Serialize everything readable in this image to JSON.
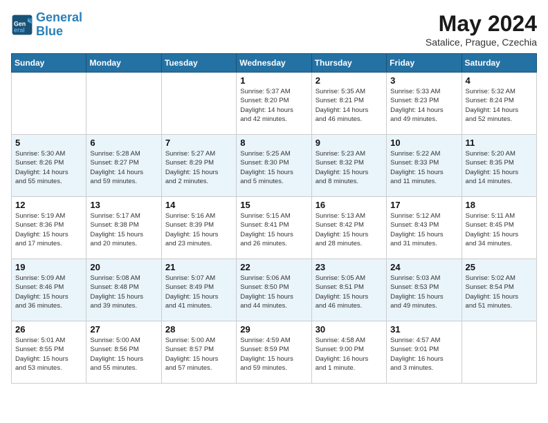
{
  "header": {
    "logo_line1": "General",
    "logo_line2": "Blue",
    "title": "May 2024",
    "location": "Satalice, Prague, Czechia"
  },
  "weekdays": [
    "Sunday",
    "Monday",
    "Tuesday",
    "Wednesday",
    "Thursday",
    "Friday",
    "Saturday"
  ],
  "weeks": [
    [
      {
        "day": "",
        "detail": ""
      },
      {
        "day": "",
        "detail": ""
      },
      {
        "day": "",
        "detail": ""
      },
      {
        "day": "1",
        "detail": "Sunrise: 5:37 AM\nSunset: 8:20 PM\nDaylight: 14 hours\nand 42 minutes."
      },
      {
        "day": "2",
        "detail": "Sunrise: 5:35 AM\nSunset: 8:21 PM\nDaylight: 14 hours\nand 46 minutes."
      },
      {
        "day": "3",
        "detail": "Sunrise: 5:33 AM\nSunset: 8:23 PM\nDaylight: 14 hours\nand 49 minutes."
      },
      {
        "day": "4",
        "detail": "Sunrise: 5:32 AM\nSunset: 8:24 PM\nDaylight: 14 hours\nand 52 minutes."
      }
    ],
    [
      {
        "day": "5",
        "detail": "Sunrise: 5:30 AM\nSunset: 8:26 PM\nDaylight: 14 hours\nand 55 minutes."
      },
      {
        "day": "6",
        "detail": "Sunrise: 5:28 AM\nSunset: 8:27 PM\nDaylight: 14 hours\nand 59 minutes."
      },
      {
        "day": "7",
        "detail": "Sunrise: 5:27 AM\nSunset: 8:29 PM\nDaylight: 15 hours\nand 2 minutes."
      },
      {
        "day": "8",
        "detail": "Sunrise: 5:25 AM\nSunset: 8:30 PM\nDaylight: 15 hours\nand 5 minutes."
      },
      {
        "day": "9",
        "detail": "Sunrise: 5:23 AM\nSunset: 8:32 PM\nDaylight: 15 hours\nand 8 minutes."
      },
      {
        "day": "10",
        "detail": "Sunrise: 5:22 AM\nSunset: 8:33 PM\nDaylight: 15 hours\nand 11 minutes."
      },
      {
        "day": "11",
        "detail": "Sunrise: 5:20 AM\nSunset: 8:35 PM\nDaylight: 15 hours\nand 14 minutes."
      }
    ],
    [
      {
        "day": "12",
        "detail": "Sunrise: 5:19 AM\nSunset: 8:36 PM\nDaylight: 15 hours\nand 17 minutes."
      },
      {
        "day": "13",
        "detail": "Sunrise: 5:17 AM\nSunset: 8:38 PM\nDaylight: 15 hours\nand 20 minutes."
      },
      {
        "day": "14",
        "detail": "Sunrise: 5:16 AM\nSunset: 8:39 PM\nDaylight: 15 hours\nand 23 minutes."
      },
      {
        "day": "15",
        "detail": "Sunrise: 5:15 AM\nSunset: 8:41 PM\nDaylight: 15 hours\nand 26 minutes."
      },
      {
        "day": "16",
        "detail": "Sunrise: 5:13 AM\nSunset: 8:42 PM\nDaylight: 15 hours\nand 28 minutes."
      },
      {
        "day": "17",
        "detail": "Sunrise: 5:12 AM\nSunset: 8:43 PM\nDaylight: 15 hours\nand 31 minutes."
      },
      {
        "day": "18",
        "detail": "Sunrise: 5:11 AM\nSunset: 8:45 PM\nDaylight: 15 hours\nand 34 minutes."
      }
    ],
    [
      {
        "day": "19",
        "detail": "Sunrise: 5:09 AM\nSunset: 8:46 PM\nDaylight: 15 hours\nand 36 minutes."
      },
      {
        "day": "20",
        "detail": "Sunrise: 5:08 AM\nSunset: 8:48 PM\nDaylight: 15 hours\nand 39 minutes."
      },
      {
        "day": "21",
        "detail": "Sunrise: 5:07 AM\nSunset: 8:49 PM\nDaylight: 15 hours\nand 41 minutes."
      },
      {
        "day": "22",
        "detail": "Sunrise: 5:06 AM\nSunset: 8:50 PM\nDaylight: 15 hours\nand 44 minutes."
      },
      {
        "day": "23",
        "detail": "Sunrise: 5:05 AM\nSunset: 8:51 PM\nDaylight: 15 hours\nand 46 minutes."
      },
      {
        "day": "24",
        "detail": "Sunrise: 5:03 AM\nSunset: 8:53 PM\nDaylight: 15 hours\nand 49 minutes."
      },
      {
        "day": "25",
        "detail": "Sunrise: 5:02 AM\nSunset: 8:54 PM\nDaylight: 15 hours\nand 51 minutes."
      }
    ],
    [
      {
        "day": "26",
        "detail": "Sunrise: 5:01 AM\nSunset: 8:55 PM\nDaylight: 15 hours\nand 53 minutes."
      },
      {
        "day": "27",
        "detail": "Sunrise: 5:00 AM\nSunset: 8:56 PM\nDaylight: 15 hours\nand 55 minutes."
      },
      {
        "day": "28",
        "detail": "Sunrise: 5:00 AM\nSunset: 8:57 PM\nDaylight: 15 hours\nand 57 minutes."
      },
      {
        "day": "29",
        "detail": "Sunrise: 4:59 AM\nSunset: 8:59 PM\nDaylight: 15 hours\nand 59 minutes."
      },
      {
        "day": "30",
        "detail": "Sunrise: 4:58 AM\nSunset: 9:00 PM\nDaylight: 16 hours\nand 1 minute."
      },
      {
        "day": "31",
        "detail": "Sunrise: 4:57 AM\nSunset: 9:01 PM\nDaylight: 16 hours\nand 3 minutes."
      },
      {
        "day": "",
        "detail": ""
      }
    ]
  ]
}
